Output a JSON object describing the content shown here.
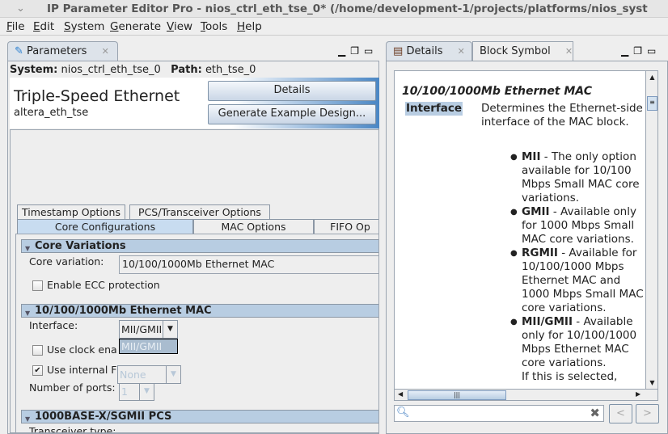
{
  "window": {
    "title": "IP Parameter Editor Pro - nios_ctrl_eth_tse_0* (/home/development-1/projects/platforms/nios_syst"
  },
  "menu": [
    "File",
    "Edit",
    "System",
    "Generate",
    "View",
    "Tools",
    "Help"
  ],
  "params": {
    "tab": "Parameters",
    "system_label": "System:",
    "system_value": "nios_ctrl_eth_tse_0",
    "path_label": "Path:",
    "path_value": "eth_tse_0",
    "ip_title": "Triple-Speed Ethernet",
    "ip_name": "altera_eth_tse",
    "details_btn": "Details",
    "generate_btn": "Generate Example Design...",
    "tabs_row1": [
      "Timestamp Options",
      "PCS/Transceiver Options"
    ],
    "tabs_row2": [
      "Core Configurations",
      "MAC Options",
      "FIFO Op"
    ],
    "sections": {
      "core": {
        "title": "Core Variations",
        "core_variation_label": "Core variation:",
        "core_variation_value": "10/100/1000Mb Ethernet MAC",
        "ecc_label": "Enable ECC protection",
        "ecc_checked": false
      },
      "mac": {
        "title": "10/100/1000Mb Ethernet MAC",
        "interface_label": "Interface:",
        "interface_value": "MII/GMII",
        "dropdown_option": "MII/GMII",
        "clock_label": "Use clock ena",
        "clock_checked": false,
        "fifo_label": "Use internal FIFO",
        "fifo_checked": true,
        "check_mark": "✔",
        "ports_label": "Number of ports:",
        "ports_value": "1"
      },
      "pcs": {
        "title": "1000BASE-X/SGMII PCS",
        "transceiver_label": "Transceiver type:",
        "transceiver_value": "None"
      }
    }
  },
  "details": {
    "tabs": [
      "Details",
      "Block Symbol"
    ],
    "heading": "10/100/1000Mb Ethernet MAC",
    "term": "Interface",
    "desc": "Determines the Ethernet-side interface of the MAC block.",
    "items": [
      {
        "name": "MII",
        "text": " - The only option available for 10/100 Mbps Small MAC core variations."
      },
      {
        "name": "GMII",
        "text": " - Available only for 1000 Mbps Small MAC core variations."
      },
      {
        "name": "RGMII",
        "text": " - Available for 10/100/1000 Mbps Ethernet MAC and 1000 Mbps Small MAC core variations."
      },
      {
        "name": "MII/GMII",
        "text": " - Available only for 10/100/1000 Mbps Ethernet MAC core variations."
      }
    ],
    "trailing": "If this is selected,",
    "search_placeholder": "",
    "prev": "<",
    "next": ">"
  }
}
